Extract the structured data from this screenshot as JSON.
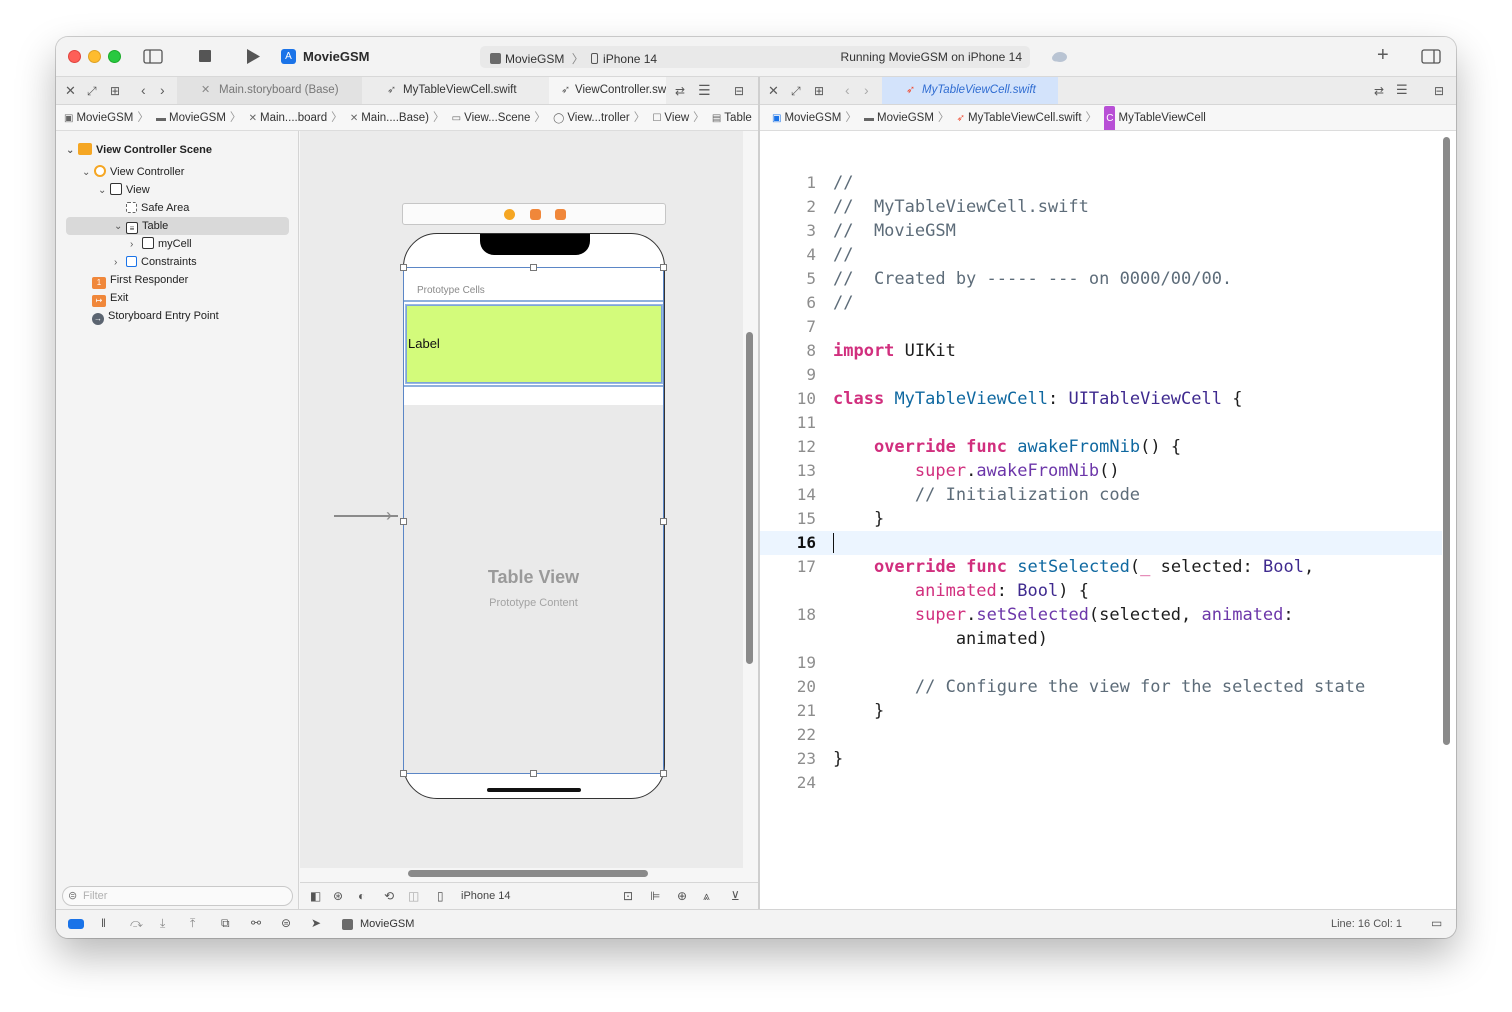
{
  "toolbar": {
    "app_title": "MovieGSM",
    "scheme_target": "MovieGSM",
    "scheme_device": "iPhone 14",
    "run_status": "Running MovieGSM on iPhone 14"
  },
  "left_tabs": [
    {
      "label": "Main.storyboard (Base)",
      "active": false
    },
    {
      "label": "MyTableViewCell.swift",
      "active": false
    },
    {
      "label": "ViewController.swift",
      "active": true
    }
  ],
  "right_tabs": [
    {
      "label": "MyTableViewCell.swift",
      "active": true
    }
  ],
  "left_jumpbar": [
    "MovieGSM",
    "MovieGSM",
    "Main....board",
    "Main....Base)",
    "View...Scene",
    "View...troller",
    "View",
    "Table"
  ],
  "right_jumpbar": [
    "MovieGSM",
    "MovieGSM",
    "MyTableViewCell.swift",
    "MyTableViewCell"
  ],
  "navigator": {
    "items": [
      {
        "label": "View Controller Scene",
        "level": 0
      },
      {
        "label": "View Controller",
        "level": 1
      },
      {
        "label": "View",
        "level": 2
      },
      {
        "label": "Safe Area",
        "level": 3
      },
      {
        "label": "Table",
        "level": 3,
        "selected": true
      },
      {
        "label": "myCell",
        "level": 4
      },
      {
        "label": "Constraints",
        "level": 4
      },
      {
        "label": "First Responder",
        "level": 1
      },
      {
        "label": "Exit",
        "level": 1
      },
      {
        "label": "Storyboard Entry Point",
        "level": 1
      }
    ],
    "filter_placeholder": "Filter"
  },
  "canvas": {
    "prototype_cells_label": "Prototype Cells",
    "cell_label": "Label",
    "table_view_title": "Table View",
    "table_view_subtitle": "Prototype Content",
    "device_label": "iPhone 14"
  },
  "code": {
    "lines": [
      {
        "n": "1",
        "text": "//"
      },
      {
        "n": "2",
        "text": "//  MyTableViewCell.swift"
      },
      {
        "n": "3",
        "text": "//  MovieGSM"
      },
      {
        "n": "4",
        "text": "//"
      },
      {
        "n": "5",
        "text": "//  Created by ----- --- on 0000/00/00."
      },
      {
        "n": "6",
        "text": "//"
      },
      {
        "n": "7",
        "text": ""
      },
      {
        "n": "8",
        "text": "import UIKit"
      },
      {
        "n": "9",
        "text": ""
      },
      {
        "n": "10",
        "text": "class MyTableViewCell: UITableViewCell {"
      },
      {
        "n": "11",
        "text": ""
      },
      {
        "n": "12",
        "text": "    override func awakeFromNib() {"
      },
      {
        "n": "13",
        "text": "        super.awakeFromNib()"
      },
      {
        "n": "14",
        "text": "        // Initialization code"
      },
      {
        "n": "15",
        "text": "    }"
      },
      {
        "n": "16",
        "text": ""
      },
      {
        "n": "17",
        "text": "    override func setSelected(_ selected: Bool,"
      },
      {
        "n": "",
        "text": "        animated: Bool) {"
      },
      {
        "n": "18",
        "text": "        super.setSelected(selected, animated:"
      },
      {
        "n": "",
        "text": "            animated)"
      },
      {
        "n": "19",
        "text": ""
      },
      {
        "n": "20",
        "text": "        // Configure the view for the selected state"
      },
      {
        "n": "21",
        "text": "    }"
      },
      {
        "n": "22",
        "text": ""
      },
      {
        "n": "23",
        "text": "}"
      },
      {
        "n": "24",
        "text": ""
      }
    ],
    "current_line": "16"
  },
  "statusbar": {
    "target": "MovieGSM",
    "position": "Line: 16  Col: 1"
  },
  "colors": {
    "accent": "#1a73e8",
    "cell_fill": "#d3fb7b",
    "keyword": "#ad3da4",
    "keyword_pink": "#d12f7e",
    "comment": "#5d6c79",
    "type": "#3f2a8f"
  }
}
